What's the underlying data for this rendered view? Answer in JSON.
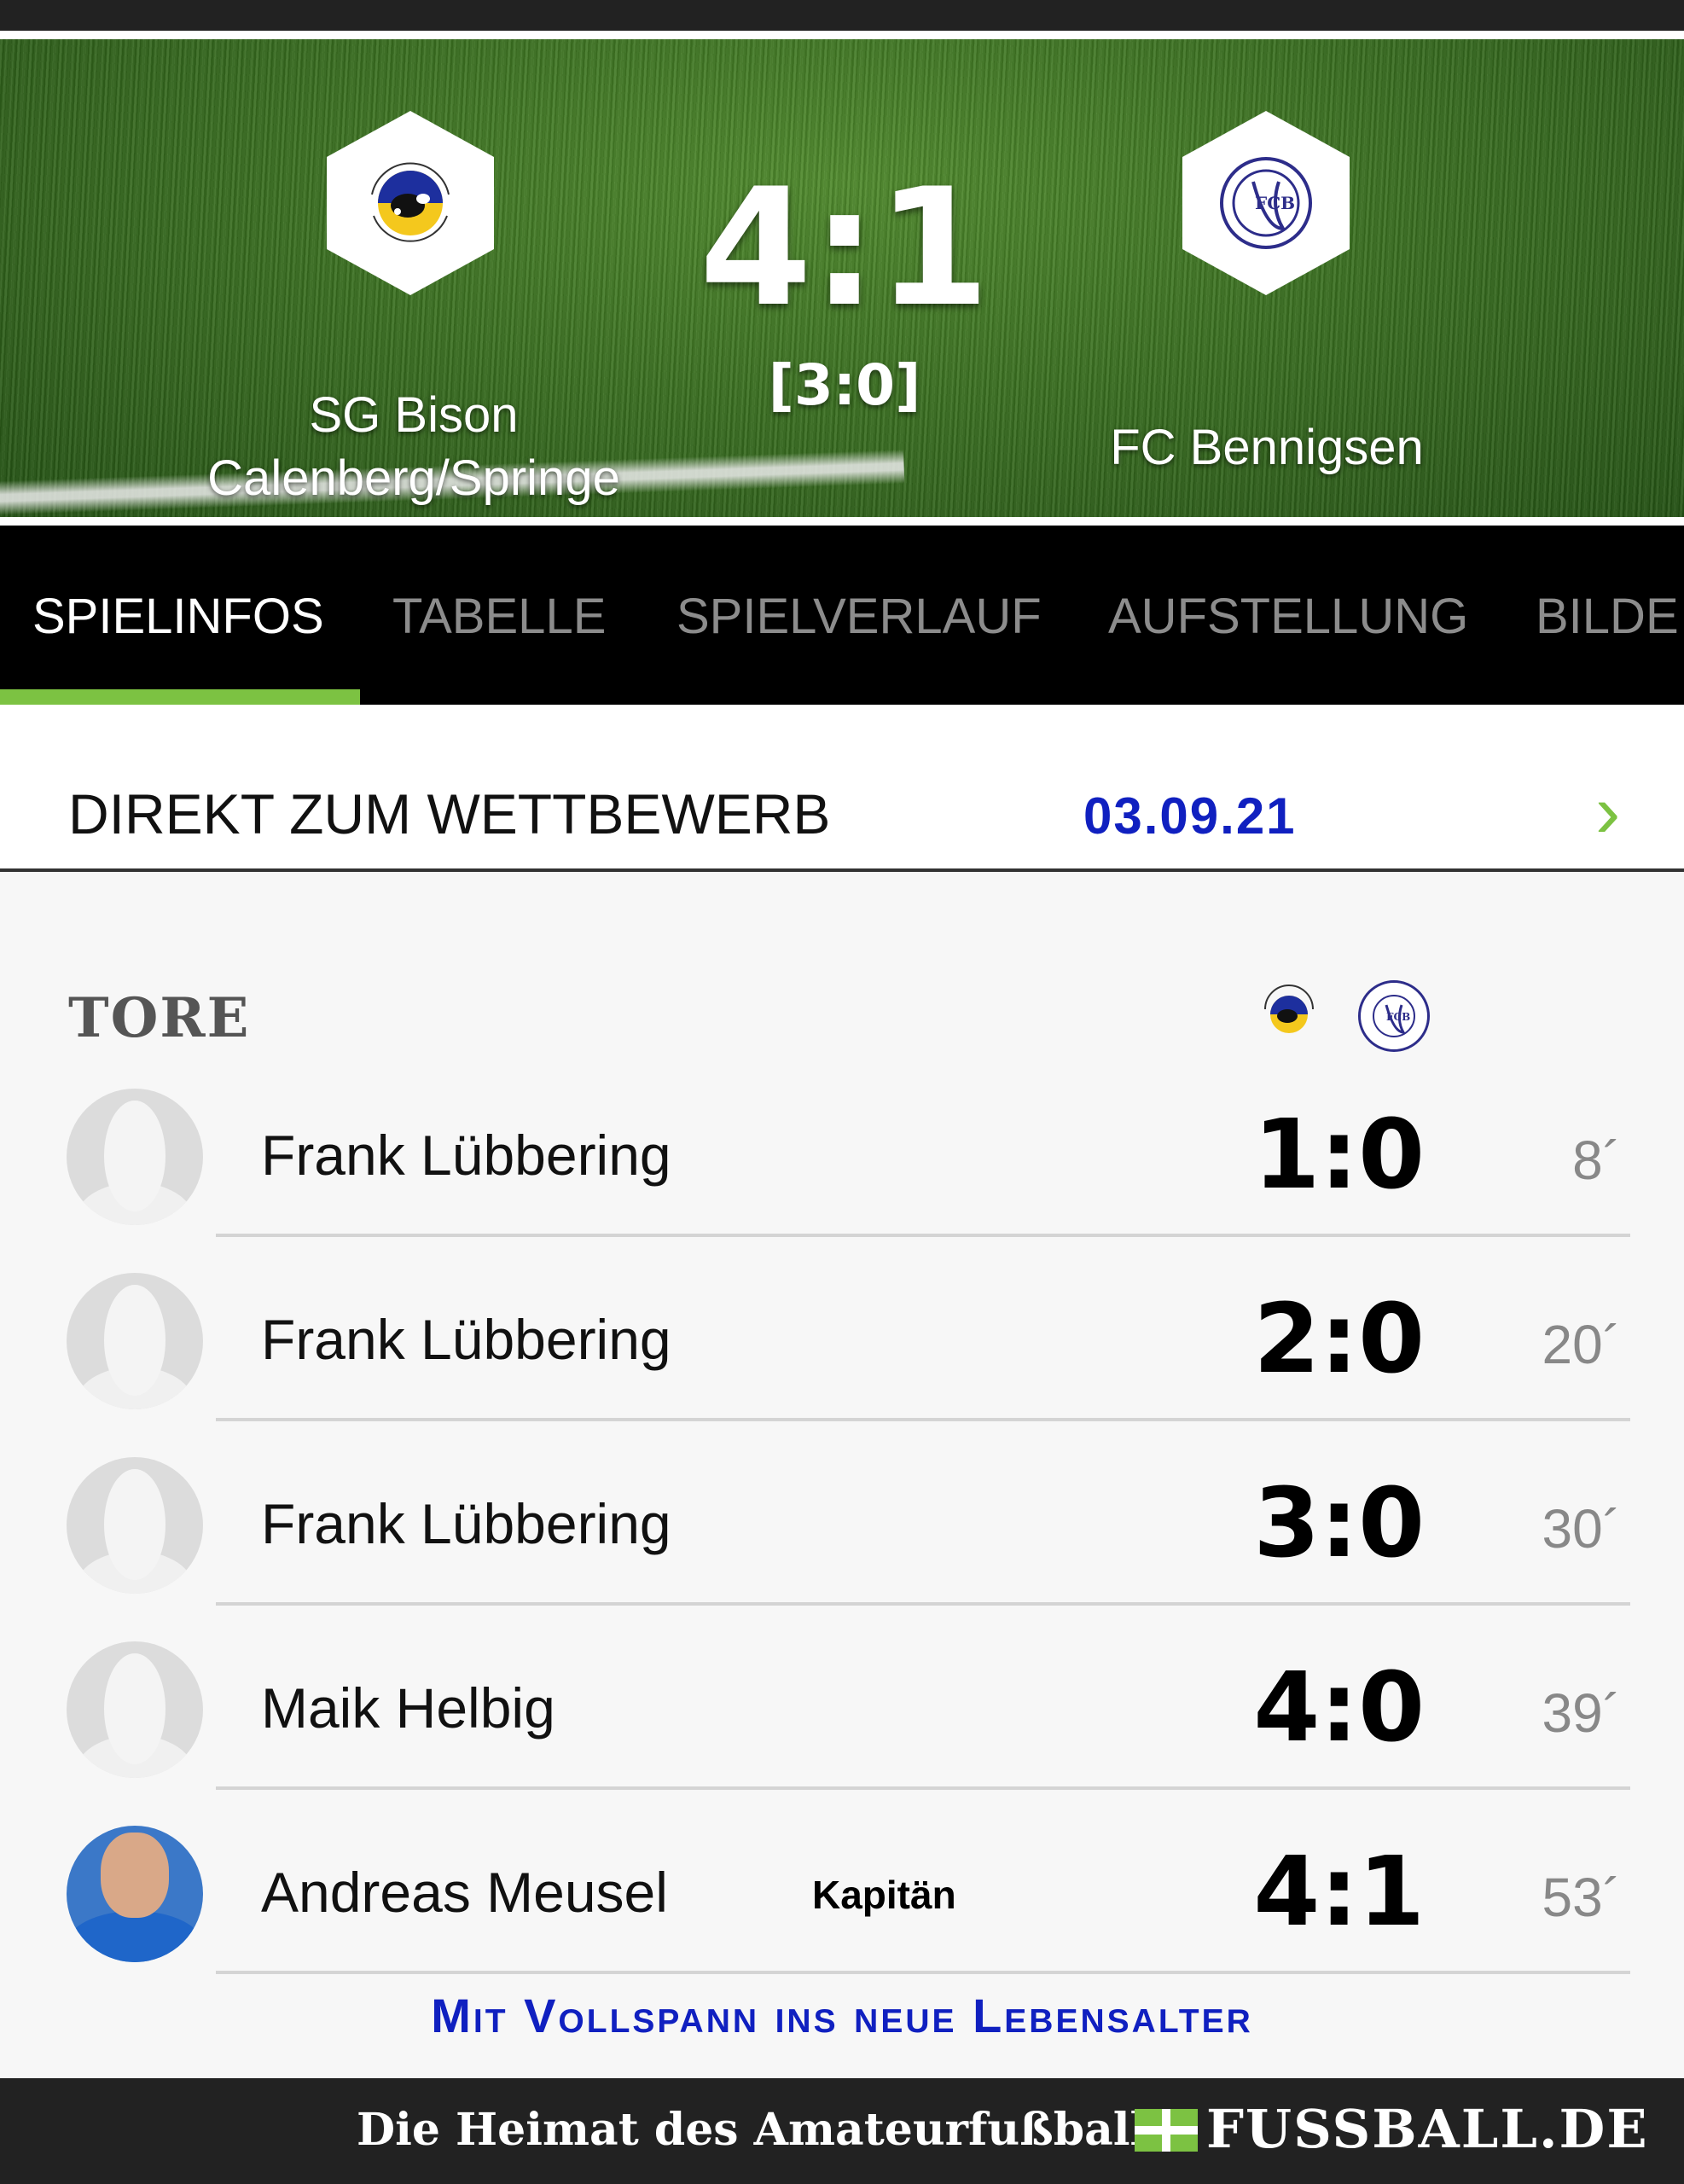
{
  "match": {
    "home_team": "SG Bison Calenberg/Springe",
    "home_team_line1": "SG Bison",
    "home_team_line2": "Calenberg/Springe",
    "away_team": "FC Bennigsen",
    "score": "4:1",
    "halftime": "[3:0]",
    "home_logo_icon": "sportclub-bison-calenberg-logo",
    "away_logo_icon": "fc-bennigsen-logo"
  },
  "tabs": [
    {
      "label": "SPIELINFOS",
      "active": true
    },
    {
      "label": "TABELLE",
      "active": false
    },
    {
      "label": "SPIELVERLAUF",
      "active": false
    },
    {
      "label": "AUFSTELLUNG",
      "active": false
    },
    {
      "label": "BILDE",
      "active": false
    }
  ],
  "competition": {
    "label": "DIREKT ZUM WETTBEWERB",
    "date": "03.09.21",
    "chevron": "›"
  },
  "goals": {
    "title": "TORE",
    "items": [
      {
        "player": "Frank Lübbering",
        "score": "1:0",
        "minute": "8´",
        "avatar": "placeholder",
        "note": ""
      },
      {
        "player": "Frank Lübbering",
        "score": "2:0",
        "minute": "20´",
        "avatar": "placeholder",
        "note": ""
      },
      {
        "player": "Frank Lübbering",
        "score": "3:0",
        "minute": "30´",
        "avatar": "placeholder",
        "note": ""
      },
      {
        "player": "Maik Helbig",
        "score": "4:0",
        "minute": "39´",
        "avatar": "placeholder",
        "note": ""
      },
      {
        "player": "Andreas Meusel",
        "score": "4:1",
        "minute": "53´",
        "avatar": "photo",
        "note": "Kapitän"
      }
    ]
  },
  "promo": "Mit Vollspann ins neue Lebensalter",
  "footer": {
    "tagline": "Die Heimat des Amateurfußballs",
    "brand": "FUSSBALL.DE"
  },
  "colors": {
    "accent_green": "#7cc242",
    "link_blue": "#1020c0",
    "tab_bar": "#000000",
    "footer": "#222222"
  }
}
